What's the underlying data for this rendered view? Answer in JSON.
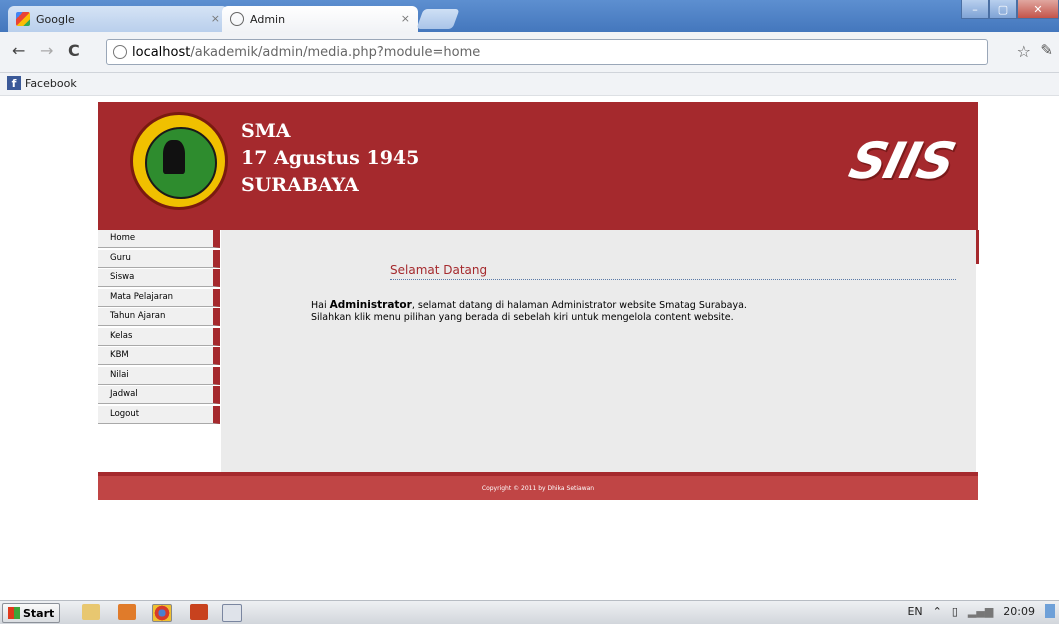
{
  "browser": {
    "tabs": [
      {
        "label": "Google",
        "active": false
      },
      {
        "label": "Admin",
        "active": true
      }
    ],
    "url_host": "localhost",
    "url_path": "/akademik/admin/media.php?module=home",
    "bookmarks": [
      {
        "label": "Facebook"
      }
    ]
  },
  "page": {
    "school_lines": [
      "SMA",
      "17 Agustus 1945",
      "SURABAYA"
    ],
    "brand": "SIIS",
    "menu": [
      "Home",
      "Guru",
      "Siswa",
      "Mata Pelajaran",
      "Tahun Ajaran",
      "Kelas",
      "KBM",
      "Nilai",
      "Jadwal",
      "Logout"
    ],
    "content": {
      "title": "Selamat Datang",
      "greeting_prefix": "Hai ",
      "user": "Administrator",
      "greeting_suffix": ", selamat datang di halaman Administrator website Smatag Surabaya.",
      "line2": "Silahkan klik menu pilihan yang berada di sebelah kiri untuk mengelola content website."
    },
    "footer": "Copyright © 2011 by Dhika Setiawan"
  },
  "taskbar": {
    "start_label": "Start",
    "language": "EN",
    "clock": "20:09"
  },
  "colors": {
    "brand_red": "#a5292d",
    "content_bg": "#ebebeb",
    "footer_red": "#c04545"
  }
}
